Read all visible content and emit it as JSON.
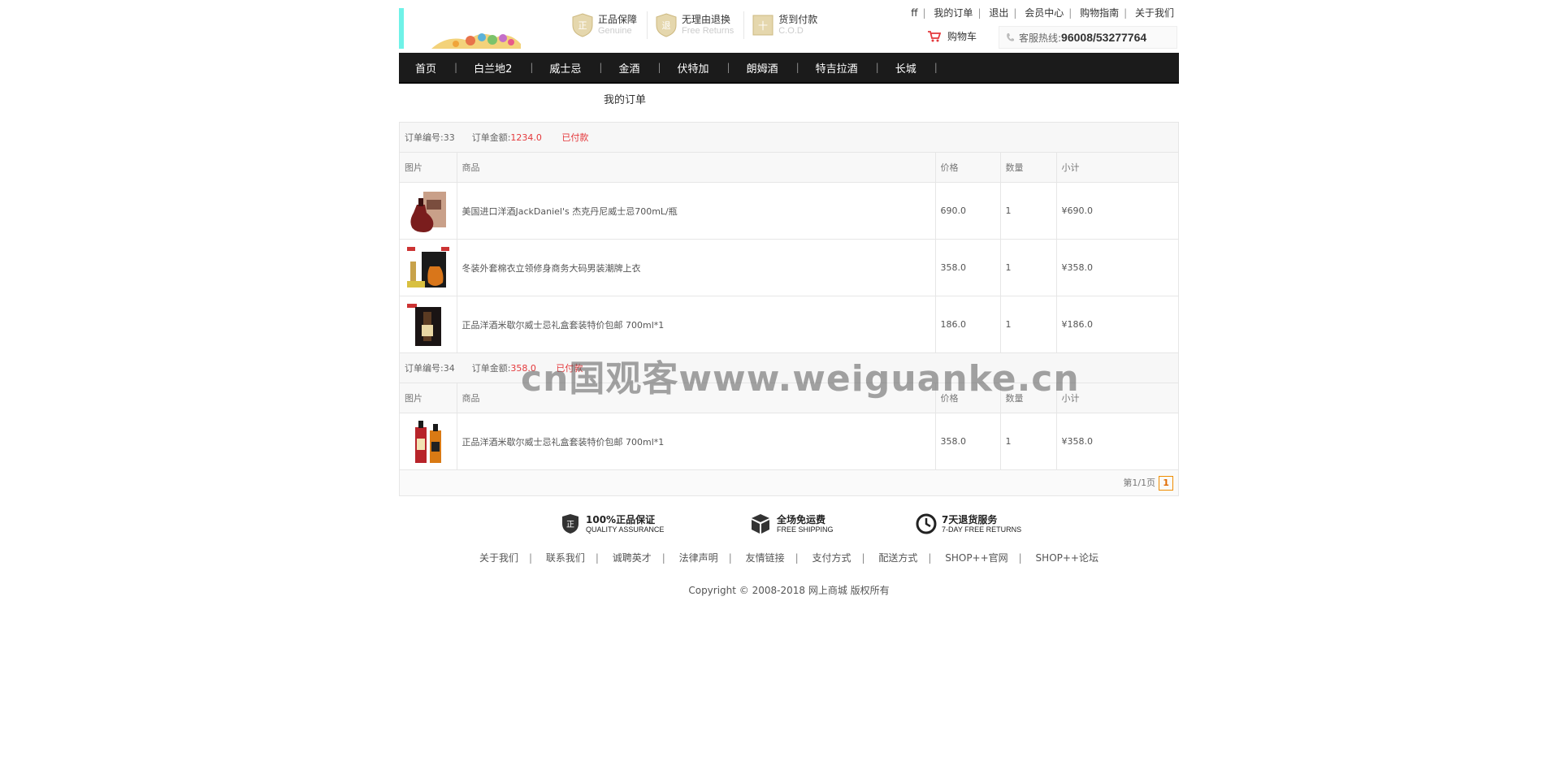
{
  "header": {
    "badges": [
      {
        "title": "正品保障",
        "subtitle": "Genuine",
        "icon": "genuine-shield-icon",
        "glyph": "正"
      },
      {
        "title": "无理由退换",
        "subtitle": "Free Returns",
        "icon": "returns-shield-icon",
        "glyph": "退"
      },
      {
        "title": "货到付款",
        "subtitle": "C.O.D",
        "icon": "cod-icon",
        "glyph": "十"
      }
    ],
    "user_links": [
      "ff",
      "我的订单",
      "退出",
      "会员中心",
      "购物指南",
      "关于我们"
    ],
    "cart_label": "购物车",
    "hotline_label": "客服热线:",
    "hotline_number": "96008/53277764"
  },
  "nav": {
    "items": [
      "首页",
      "白兰地2",
      "威士忌",
      "金酒",
      "伏特加",
      "朗姆酒",
      "特吉拉酒",
      "长城"
    ]
  },
  "page_title": "我的订单",
  "orders": {
    "columns": [
      "图片",
      "商品",
      "价格",
      "数量",
      "小计"
    ],
    "order_no_label": "订单编号:",
    "amount_label": "订单金额:",
    "list": [
      {
        "order_no": "33",
        "amount": "1234.0",
        "status": "已付款",
        "items": [
          {
            "name": "美国进口洋酒JackDaniel's 杰克丹尼威士忌700mL/瓶",
            "price": "690.0",
            "qty": "1",
            "subtotal": "¥690.0"
          },
          {
            "name": "冬装外套棉衣立领修身商务大码男装潮牌上衣",
            "price": "358.0",
            "qty": "1",
            "subtotal": "¥358.0"
          },
          {
            "name": "正品洋酒米歇尔威士忌礼盒套装特价包邮 700ml*1",
            "price": "186.0",
            "qty": "1",
            "subtotal": "¥186.0"
          }
        ]
      },
      {
        "order_no": "34",
        "amount": "358.0",
        "status": "已付款",
        "items": [
          {
            "name": "正品洋酒米歇尔威士忌礼盒套装特价包邮 700ml*1",
            "price": "358.0",
            "qty": "1",
            "subtotal": "¥358.0"
          }
        ]
      }
    ],
    "pager_text": "第1/1页",
    "current_page": "1"
  },
  "footer": {
    "guarantees": [
      {
        "title": "100%正品保证",
        "subtitle": "QUALITY ASSURANCE",
        "icon": "quality-shield-icon"
      },
      {
        "title": "全场免运费",
        "subtitle": "FREE SHIPPING",
        "icon": "shipping-box-icon"
      },
      {
        "title": "7天退货服务",
        "subtitle": "7-DAY FREE RETURNS",
        "icon": "clock-icon"
      }
    ],
    "links": [
      "关于我们",
      "联系我们",
      "诚聘英才",
      "法律声明",
      "友情链接",
      "支付方式",
      "配送方式",
      "SHOP++官网",
      "SHOP++论坛"
    ],
    "copyright": "Copyright © 2008-2018 网上商城 版权所有"
  },
  "watermark": "cn国观客www.weiguanke.cn",
  "colors": {
    "accent_red": "#e4393c",
    "nav_bg": "#1b1b1b",
    "pager_orange": "#f08c00"
  }
}
